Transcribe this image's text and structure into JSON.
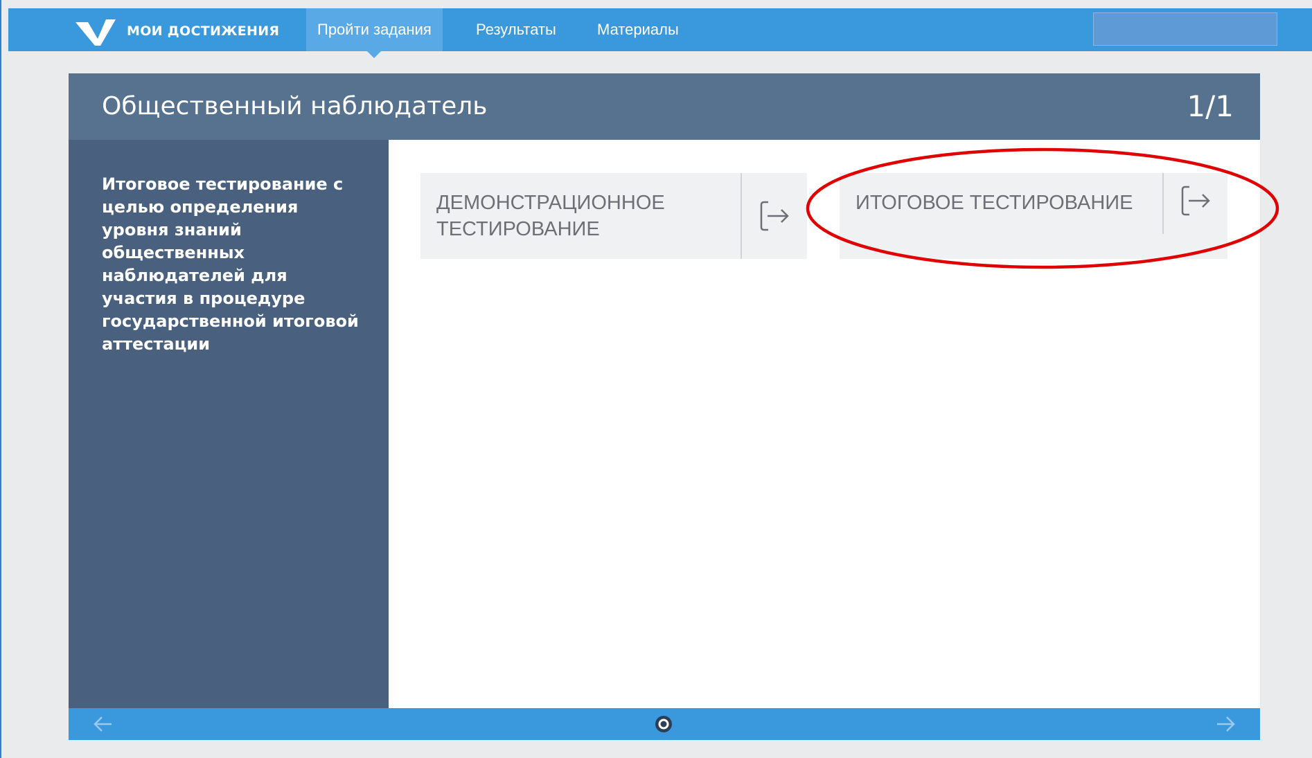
{
  "app": {
    "logo_text": "МОИ ДОСТИЖЕНИЯ",
    "nav": [
      {
        "label": "Пройти задания",
        "active": true
      },
      {
        "label": "Результаты",
        "active": false
      },
      {
        "label": "Материалы",
        "active": false
      }
    ]
  },
  "panel": {
    "title": "Общественный наблюдатель",
    "counter": "1/1",
    "description": "Итоговое тестирование с целью определения уровня знаний общественных наблюдателей для участия в процедуре государственной итоговой аттестации",
    "cards": [
      {
        "label": "ДЕМОНСТРАЦИОННОЕ ТЕСТИРОВАНИЕ",
        "icon": "exit-arrow-icon"
      },
      {
        "label": "ИТОГОВОЕ ТЕСТИРОВАНИЕ",
        "icon": "exit-arrow-icon"
      }
    ]
  },
  "footer": {
    "prev_icon": "arrow-left-icon",
    "page_dot_icon": "page-indicator-icon",
    "next_icon": "arrow-right-icon"
  },
  "colors": {
    "topbar": "#3a98dc",
    "nav_active": "#58a9e5",
    "panel_header": "#57728f",
    "sidebar": "#49617e",
    "card_bg": "#f0f1f2",
    "annotation": "#e00000"
  }
}
